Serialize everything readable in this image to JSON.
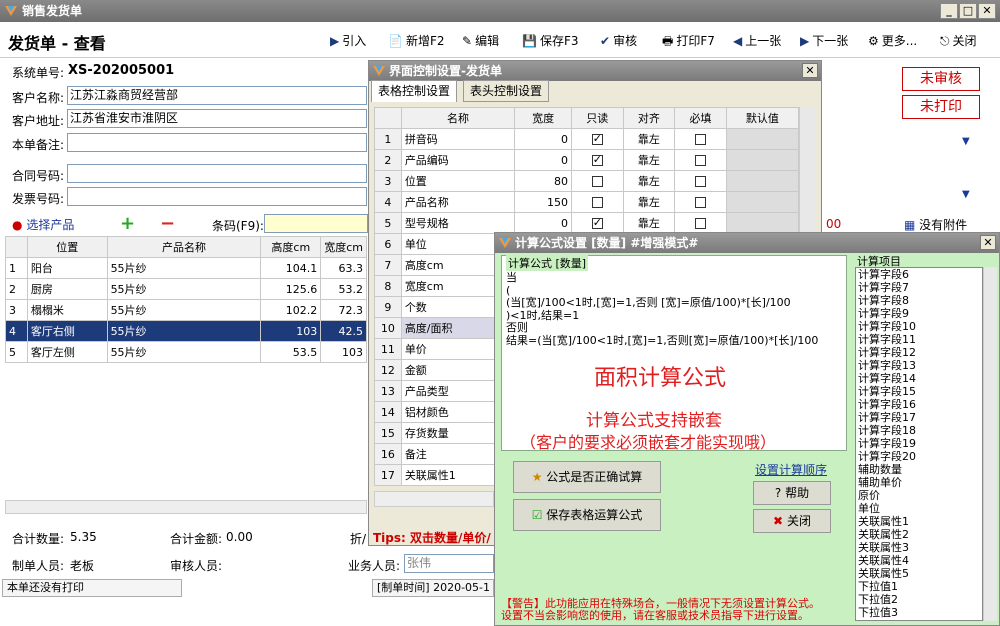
{
  "window": {
    "title": "销售发货单",
    "min": "_",
    "max": "□",
    "close": "✕"
  },
  "toolbar": {
    "page_title": "发货单 - 查看",
    "import": "引入",
    "new": "新增F2",
    "edit": "编辑",
    "save": "保存F3",
    "audit": "审核",
    "print": "打印F7",
    "prev": "上一张",
    "next": "下一张",
    "more": "更多...",
    "close": "关闭"
  },
  "form": {
    "sysno_label": "系统单号:",
    "sysno": "XS-202005001",
    "customer_label": "客户名称:",
    "customer": "江苏江淼商贸经营部",
    "address_label": "客户地址:",
    "address": "江苏省淮安市淮阴区",
    "note_label": "本单备注:",
    "contract_label": "合同号码:",
    "invoice_label": "发票号码:",
    "stamp_audit": "未审核",
    "stamp_print": "未打印",
    "choose_product": "选择产品",
    "barcode_label": "条码(F9):",
    "attachment": "没有附件",
    "attachment_partial": "00"
  },
  "main_grid": {
    "headers": [
      "",
      "位置",
      "产品名称",
      "高度cm",
      "宽度cm"
    ],
    "rows": [
      [
        "1",
        "阳台",
        "55片纱",
        "104.1",
        "63.3"
      ],
      [
        "2",
        "厨房",
        "55片纱",
        "125.6",
        "53.2"
      ],
      [
        "3",
        "榻榻米",
        "55片纱",
        "102.2",
        "72.3"
      ],
      [
        "4",
        "客厅右侧",
        "55片纱",
        "103",
        "42.5"
      ],
      [
        "5",
        "客厅左侧",
        "55片纱",
        "53.5",
        "103"
      ]
    ],
    "selected": 3
  },
  "totals": {
    "qty_label": "合计数量:",
    "qty": "5.35",
    "amount_label": "合计金额:",
    "amount": "0.00",
    "discount_partial": "折/"
  },
  "people": {
    "maker_label": "制单人员:",
    "maker": "老板",
    "auditor_label": "审核人员:",
    "sales_label": "业务人员:",
    "sales": "张伟"
  },
  "status": {
    "print": "本单还没有打印",
    "time": "[制单时间] 2020-05-1"
  },
  "ctrl_dialog": {
    "title": "界面控制设置-发货单",
    "tab1": "表格控制设置",
    "tab2": "表头控制设置",
    "headers": [
      "",
      "名称",
      "宽度",
      "只读",
      "对齐",
      "必填",
      "默认值"
    ],
    "rows": [
      [
        "1",
        "拼音码",
        "0",
        true,
        "靠左",
        false
      ],
      [
        "2",
        "产品编码",
        "0",
        true,
        "靠左",
        false
      ],
      [
        "3",
        "位置",
        "80",
        false,
        "靠左",
        false
      ],
      [
        "4",
        "产品名称",
        "150",
        false,
        "靠左",
        false
      ],
      [
        "5",
        "型号规格",
        "0",
        true,
        "靠左",
        false
      ],
      [
        "6",
        "单位",
        "",
        false,
        "",
        false
      ],
      [
        "7",
        "高度cm",
        "",
        false,
        "",
        false
      ],
      [
        "8",
        "宽度cm",
        "",
        false,
        "",
        false
      ],
      [
        "9",
        "个数",
        "",
        false,
        "",
        false
      ],
      [
        "10",
        "高度/面积",
        "",
        false,
        "",
        false
      ],
      [
        "11",
        "单价",
        "",
        false,
        "",
        false
      ],
      [
        "12",
        "金额",
        "",
        false,
        "",
        false
      ],
      [
        "13",
        "产品类型",
        "",
        false,
        "",
        false
      ],
      [
        "14",
        "铝材颜色",
        "",
        false,
        "",
        false
      ],
      [
        "15",
        "存货数量",
        "",
        false,
        "",
        false
      ],
      [
        "16",
        "备注",
        "",
        false,
        "",
        false
      ],
      [
        "17",
        "关联属性1",
        "",
        false,
        "",
        false
      ]
    ],
    "tips": "Tips: 双击数量/单价/"
  },
  "formula_dialog": {
    "title": "计算公式设置 [数量]  #增强模式#",
    "group_label": "计算公式 [数量]",
    "code": [
      "当",
      "(",
      " (当[宽]/100<1时,[宽]=1,否则 [宽]=原值/100)*[长]/100",
      ")<1时,结果=1",
      "否则",
      "结果=(当[宽]/100<1时,[宽]=1,否则[宽]=原值/100)*[长]/100"
    ],
    "overlay1": "面积计算公式",
    "overlay2": "计算公式支持嵌套",
    "overlay3": "（客户的要求必须嵌套才能实现哦）",
    "btn_test": "公式是否正确试算",
    "btn_save": "保存表格运算公式",
    "link_order": "设置计算顺序",
    "btn_help": "帮助",
    "btn_close": "关闭",
    "warning1": "【警告】此功能应用在特殊场合，一般情况下无须设置计算公式。",
    "warning2": "设置不当会影响您的使用，请在客服或技术员指导下进行设置。",
    "items_label": "计算项目",
    "items": [
      "计算字段6",
      "计算字段7",
      "计算字段8",
      "计算字段9",
      "计算字段10",
      "计算字段11",
      "计算字段12",
      "计算字段13",
      "计算字段14",
      "计算字段15",
      "计算字段16",
      "计算字段17",
      "计算字段18",
      "计算字段19",
      "计算字段20",
      "辅助数量",
      "辅助单价",
      "原价",
      "单位",
      "关联属性1",
      "关联属性2",
      "关联属性3",
      "关联属性4",
      "关联属性5",
      "下拉值1",
      "下拉值2",
      "下拉值3"
    ]
  },
  "colors": {
    "title_bar": "#7a7a7a",
    "selected_row": "#1d3a7a",
    "formula_bg": "#c8f0c0",
    "red": "#e02020"
  }
}
